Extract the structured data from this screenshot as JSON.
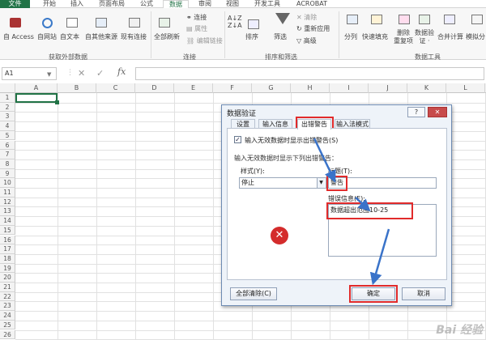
{
  "ribbon_tabs": [
    "文件",
    "开始",
    "插入",
    "页面布局",
    "公式",
    "数据",
    "审阅",
    "视图",
    "开发工具",
    "ACROBAT"
  ],
  "ribbon": {
    "external": {
      "access": "自 Access",
      "web": "自网站",
      "text": "自文本",
      "other": "自其他来源",
      "existing": "现有连接",
      "group": "获取外部数据"
    },
    "connections": {
      "refresh": "全部刷新",
      "connections": "连接",
      "properties": "属性",
      "edit_links": "编辑链接",
      "group": "连接"
    },
    "sort": {
      "sort": "排序",
      "filter": "筛选",
      "clear": "清除",
      "reapply": "重新应用",
      "advanced": "高级",
      "group": "排序和筛选"
    },
    "tools": {
      "split": "分列",
      "flash_fill": "快速填充",
      "remove_dup": "删除\n重复项",
      "validation": "数据验\n证 ·",
      "consolidate": "合并计算",
      "whatif": "模拟分",
      "group": "数据工具"
    }
  },
  "formula_bar": {
    "name_box": "A1",
    "fx": "fx",
    "value": ""
  },
  "columns": [
    "A",
    "B",
    "C",
    "D",
    "E",
    "F",
    "G",
    "H",
    "I",
    "J",
    "K",
    "L"
  ],
  "rows": [
    "1",
    "2",
    "3",
    "4",
    "5",
    "6",
    "7",
    "8",
    "9",
    "10",
    "11",
    "12",
    "13",
    "14",
    "15",
    "16",
    "17",
    "18",
    "19",
    "20",
    "21",
    "22",
    "23",
    "24",
    "25",
    "26"
  ],
  "dialog": {
    "title": "数据验证",
    "help": "?",
    "close": "✕",
    "tabs": [
      "设置",
      "输入信息",
      "出错警告",
      "输入法模式"
    ],
    "show_error_checkbox": "输入无效数据时显示出错警告(S)",
    "section": "输入无效数据时显示下列出错警告：",
    "style_label": "样式(Y):",
    "style_value": "停止",
    "title_label": "标题(T):",
    "title_value": "警告",
    "message_label": "错误信息(E):",
    "message_value": "数据超出范围10-25",
    "clear_all": "全部清除(C)",
    "ok": "确定",
    "cancel": "取消"
  },
  "watermark": "Bai 经验",
  "colors": {
    "excel_green": "#217346",
    "annotation_red": "#e12b2b",
    "annotation_blue": "#3a73c9"
  }
}
